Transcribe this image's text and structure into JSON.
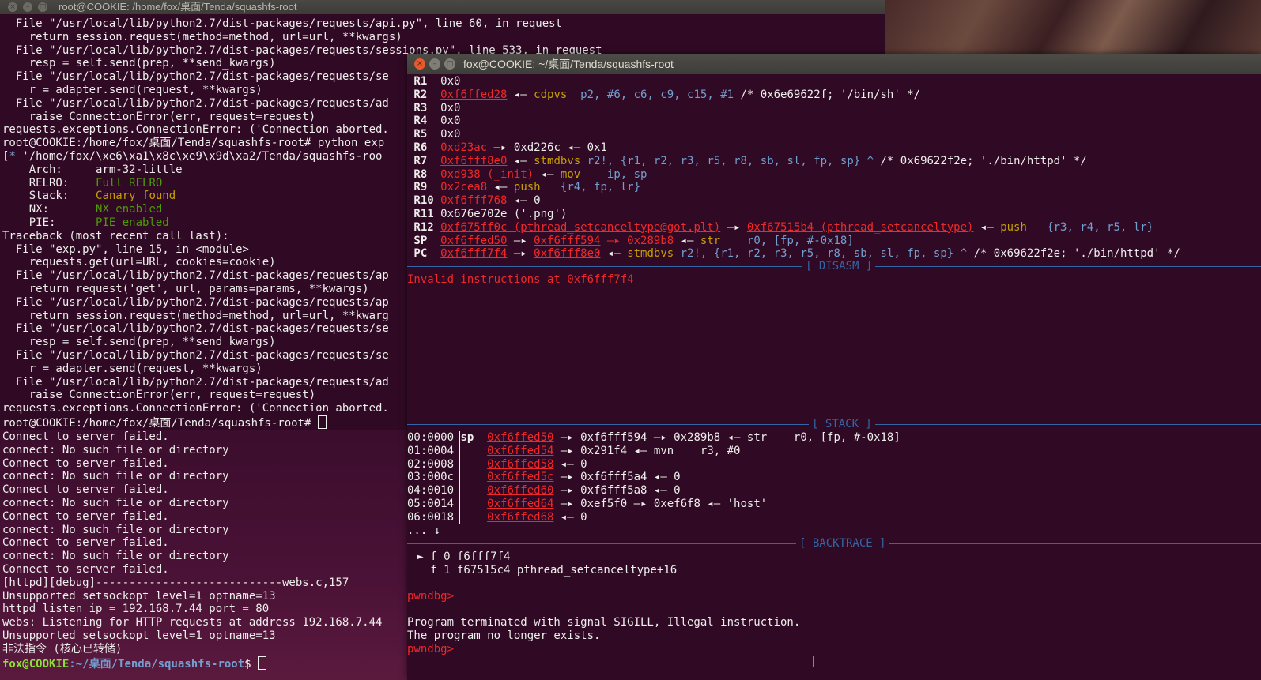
{
  "window1": {
    "title": "root@COOKIE: /home/fox/桌面/Tenda/squashfs-root",
    "lines": [
      "  File \"/usr/local/lib/python2.7/dist-packages/requests/api.py\", line 60, in request",
      "    return session.request(method=method, url=url, **kwargs)",
      "  File \"/usr/local/lib/python2.7/dist-packages/requests/sessions.py\", line 533, in request",
      "    resp = self.send(prep, **send_kwargs)",
      "  File \"/usr/local/lib/python2.7/dist-packages/requests/se",
      "    r = adapter.send(request, **kwargs)",
      "  File \"/usr/local/lib/python2.7/dist-packages/requests/ad",
      "    raise ConnectionError(err, request=request)",
      "requests.exceptions.ConnectionError: ('Connection aborted.",
      "root@COOKIE:/home/fox/桌面/Tenda/squashfs-root# python exp",
      "[*] '/home/fox/\\xe6\\xa1\\x8c\\xe9\\x9d\\xa2/Tenda/squashfs-roo",
      "    Arch:     arm-32-little",
      "    RELRO:    Full RELRO",
      "    Stack:    Canary found",
      "    NX:       NX enabled",
      "    PIE:      PIE enabled",
      "Traceback (most recent call last):",
      "  File \"exp.py\", line 15, in <module>",
      "    requests.get(url=URL, cookies=cookie)",
      "  File \"/usr/local/lib/python2.7/dist-packages/requests/ap",
      "    return request('get', url, params=params, **kwargs)",
      "  File \"/usr/local/lib/python2.7/dist-packages/requests/ap",
      "    return session.request(method=method, url=url, **kwarg",
      "  File \"/usr/local/lib/python2.7/dist-packages/requests/se",
      "    resp = self.send(prep, **send_kwargs)",
      "  File \"/usr/local/lib/python2.7/dist-packages/requests/se",
      "    r = adapter.send(request, **kwargs)",
      "  File \"/usr/local/lib/python2.7/dist-packages/requests/ad",
      "    raise ConnectionError(err, request=request)",
      "requests.exceptions.ConnectionError: ('Connection aborted.",
      "root@COOKIE:/home/fox/桌面/Tenda/squashfs-root# "
    ]
  },
  "lower_terminal": {
    "lines": [
      "Connect to server failed.",
      "connect: No such file or directory",
      "Connect to server failed.",
      "connect: No such file or directory",
      "Connect to server failed.",
      "connect: No such file or directory",
      "Connect to server failed.",
      "connect: No such file or directory",
      "Connect to server failed.",
      "connect: No such file or directory",
      "Connect to server failed.",
      "[httpd][debug]----------------------------webs.c,157",
      "Unsupported setsockopt level=1 optname=13",
      "httpd listen ip = 192.168.7.44 port = 80",
      "webs: Listening for HTTP requests at address 192.168.7.44",
      "Unsupported setsockopt level=1 optname=13",
      "非法指令 (核心已转储)"
    ],
    "prompt_user": "fox@COOKIE",
    "prompt_path": ":~/桌面/Tenda/squashfs-root",
    "prompt_sym": "$ "
  },
  "window2": {
    "title": "fox@COOKIE: ~/桌面/Tenda/squashfs-root",
    "close_glyph": "×",
    "min_glyph": "–",
    "max_glyph": "□",
    "regs": [
      {
        "name": "R1",
        "val": "0x0"
      },
      {
        "name": "R2",
        "val": "0xf6ffed28",
        "arrow": " ◂— ",
        "ins": "cdpvs",
        "args": "  p2, #6, c6, c9, c15, #1",
        "comment": " /* 0x6e69622f; '/bin/sh' */"
      },
      {
        "name": "R3",
        "val": "0x0"
      },
      {
        "name": "R4",
        "val": "0x0"
      },
      {
        "name": "R5",
        "val": "0x0"
      },
      {
        "name": "R6",
        "val": "0xd23ac",
        "chain": " —▸ 0xd226c ◂— 0x1"
      },
      {
        "name": "R7",
        "val": "0xf6fff8e0",
        "arrow": " ◂— ",
        "ins": "stmdbvs",
        "args": " r2!, {r1, r2, r3, r5, r8, sb, sl, fp, sp} ^",
        "comment": " /* 0x69622f2e; './bin/httpd' */"
      },
      {
        "name": "R8",
        "val": "0xd938 (_init)",
        "arrow": " ◂— ",
        "ins": "mov",
        "args": "    ip, sp"
      },
      {
        "name": "R9",
        "val": "0x2cea8",
        "arrow": " ◂— ",
        "ins": "push",
        "args": "   {r4, fp, lr}"
      },
      {
        "name": "R10",
        "val": "0xf6fff768",
        "chain": " ◂— 0"
      },
      {
        "name": "R11",
        "val": "0x676e702e ('.png')"
      },
      {
        "name": "R12",
        "val": "0xf675ff0c (pthread_setcanceltype@got.plt)",
        "chain2": " —▸ ",
        "target": "0xf67515b4 (pthread_setcanceltype)",
        "arrow": " ◂— ",
        "ins": "push",
        "args": "   {r3, r4, r5, lr}"
      },
      {
        "name": "SP",
        "val": "0xf6ffed50",
        "chain2": " —▸ ",
        "target": "0xf6fff594",
        "chain3": " —▸ 0x289b8",
        "arrow": " ◂— ",
        "ins": "str",
        "args": "    r0, [fp, #-0x18]"
      },
      {
        "name": "PC",
        "val": "0xf6fff7f4",
        "chain2": " —▸ ",
        "target": "0xf6fff8e0",
        "arrow": " ◂— ",
        "ins": "stmdbvs",
        "args": " r2!, {r1, r2, r3, r5, r8, sb, sl, fp, sp} ^",
        "comment": " /* 0x69622f2e; './bin/httpd' */"
      }
    ],
    "disasm_label": "[ DISASM ]",
    "disasm_error": "Invalid instructions at 0xf6fff7f4",
    "stack_label": "[ STACK ]",
    "stack": [
      {
        "off": "00:0000",
        "reg": "sp",
        "addr": "0xf6ffed50",
        "rest": " —▸ 0xf6fff594 —▸ 0x289b8 ◂— str    r0, [fp, #-0x18]"
      },
      {
        "off": "01:0004",
        "reg": "",
        "addr": "0xf6ffed54",
        "rest": " —▸ 0x291f4 ◂— mvn    r3, #0"
      },
      {
        "off": "02:0008",
        "reg": "",
        "addr": "0xf6ffed58",
        "rest": " ◂— 0"
      },
      {
        "off": "03:000c",
        "reg": "",
        "addr": "0xf6ffed5c",
        "rest": " —▸ 0xf6fff5a4 ◂— 0"
      },
      {
        "off": "04:0010",
        "reg": "",
        "addr": "0xf6ffed60",
        "rest": " —▸ 0xf6fff5a8 ◂— 0"
      },
      {
        "off": "05:0014",
        "reg": "",
        "addr": "0xf6ffed64",
        "rest": " —▸ 0xef5f0 —▸ 0xef6f8 ◂— 'host'"
      },
      {
        "off": "06:0018",
        "reg": "",
        "addr": "0xf6ffed68",
        "rest": " ◂— 0"
      }
    ],
    "stack_more": "... ↓",
    "backtrace_label": "[ BACKTRACE ]",
    "backtrace": [
      " ► f 0 f6fff7f4",
      "   f 1 f67515c4 pthread_setcanceltype+16"
    ],
    "prompt": "pwndbg>",
    "term_msg1": "Program terminated with signal SIGILL, Illegal instruction.",
    "term_msg2": "The program no longer exists."
  },
  "colors": {
    "terminal_bg": "#300a24",
    "address_red": "#ef2929",
    "instruction_yellow": "#c4a000",
    "register_blue": "#729fcf",
    "separator_blue": "#3465a4",
    "prompt_green": "#8ae234"
  }
}
